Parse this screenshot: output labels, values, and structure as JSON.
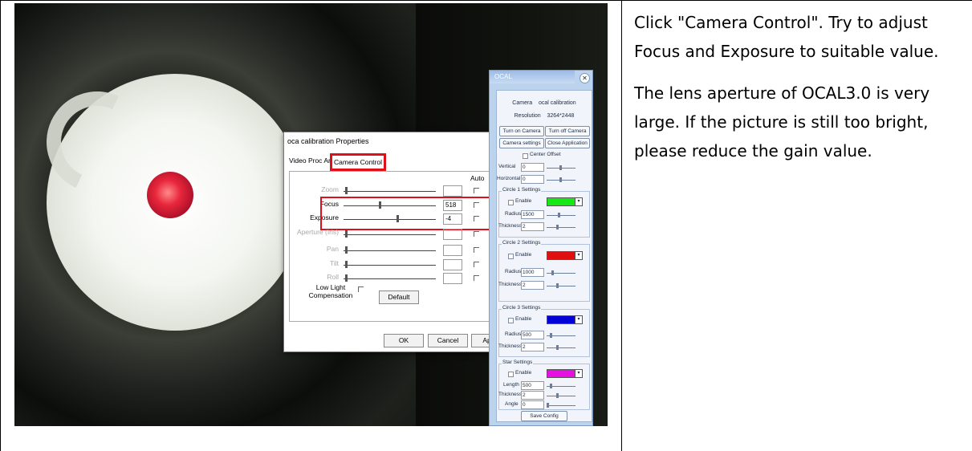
{
  "paragraphs": [
    "Click \"Camera Control\". Try to adjust Focus and Exposure to suitable value.",
    "The lens aperture of OCAL3.0 is very large. If the picture is still too bright, please reduce the gain value."
  ],
  "dialog": {
    "title": "oca calibration Properties",
    "close": "✕",
    "tab_video": "Video Proc Amp",
    "tab_camera": "Camera Control",
    "auto": "Auto",
    "controls": [
      {
        "label": "Zoom",
        "value": "",
        "enabled": false
      },
      {
        "label": "Focus",
        "value": "518",
        "enabled": true
      },
      {
        "label": "Exposure",
        "value": "-4",
        "enabled": true
      },
      {
        "label": "Aperture (Iris)",
        "value": "",
        "enabled": false
      },
      {
        "label": "Pan",
        "value": "",
        "enabled": false
      },
      {
        "label": "Tilt",
        "value": "",
        "enabled": false
      },
      {
        "label": "Roll",
        "value": "",
        "enabled": false
      }
    ],
    "low_light": "Low Light Compensation",
    "default": "Default",
    "ok": "OK",
    "cancel": "Cancel",
    "apply": "Apply"
  },
  "ocal": {
    "title": "OCAL",
    "close": "✕",
    "camera_label": "Camera",
    "camera_value": "ocal calibration",
    "resolution_label": "Resolution",
    "resolution_value": "3264*2448",
    "turn_on": "Turn on Camera",
    "turn_off": "Turn off Camera",
    "camera_settings": "Camera settings",
    "close_app": "Close Application",
    "center_offset": "Center Offset",
    "vertical_label": "Vertical",
    "vertical_value": "0",
    "horizontal_label": "Horizontal",
    "horizontal_value": "0",
    "circle1": "Circle 1 Settings",
    "circle2": "Circle 2 Settings",
    "circle3": "Circle 3 Settings",
    "star": "Star Settings",
    "enable": "Enable",
    "radius": "Radius",
    "thickness": "Thickness",
    "length": "Length",
    "angle": "Angle",
    "c1_radius": "1500",
    "c1_thickness": "2",
    "c2_radius": "1000",
    "c2_thickness": "2",
    "c3_radius": "500",
    "c3_thickness": "2",
    "star_length": "500",
    "star_thickness": "2",
    "star_angle": "0",
    "save": "Save Config",
    "colors": {
      "c1": "#16e816",
      "c2": "#e01010",
      "c3": "#0000d8",
      "star": "#e610e0"
    }
  }
}
